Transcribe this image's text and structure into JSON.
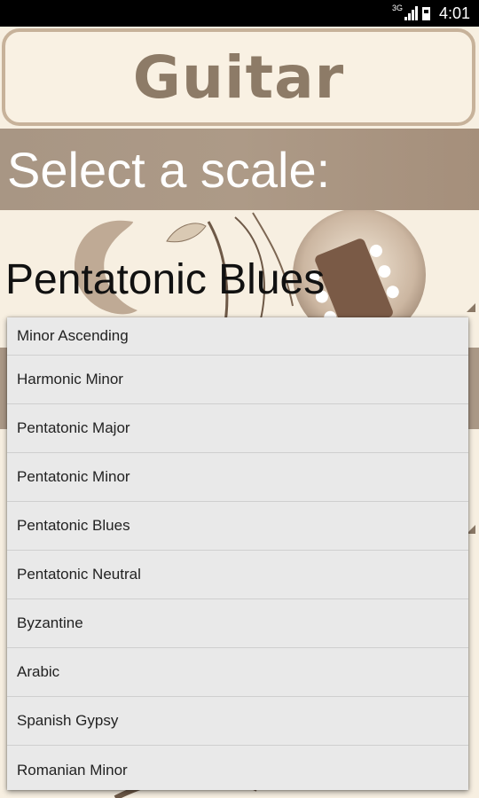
{
  "status_bar": {
    "network": "3G",
    "time": "4:01"
  },
  "app": {
    "title": "Guitar"
  },
  "scale_header": "Select a scale:",
  "spinner": {
    "selected": "Pentatonic Blues"
  },
  "dropdown": {
    "options": [
      "Minor Ascending",
      "Harmonic Minor",
      "Pentatonic Major",
      "Pentatonic Minor",
      "Pentatonic Blues",
      "Pentatonic Neutral",
      "Byzantine",
      "Arabic",
      "Spanish Gypsy",
      "Romanian Minor"
    ]
  },
  "colors": {
    "title_text": "#8d7b67",
    "header_band": "#a89684",
    "background": "#f7efe1",
    "dropdown_bg": "#e9e9e9"
  }
}
